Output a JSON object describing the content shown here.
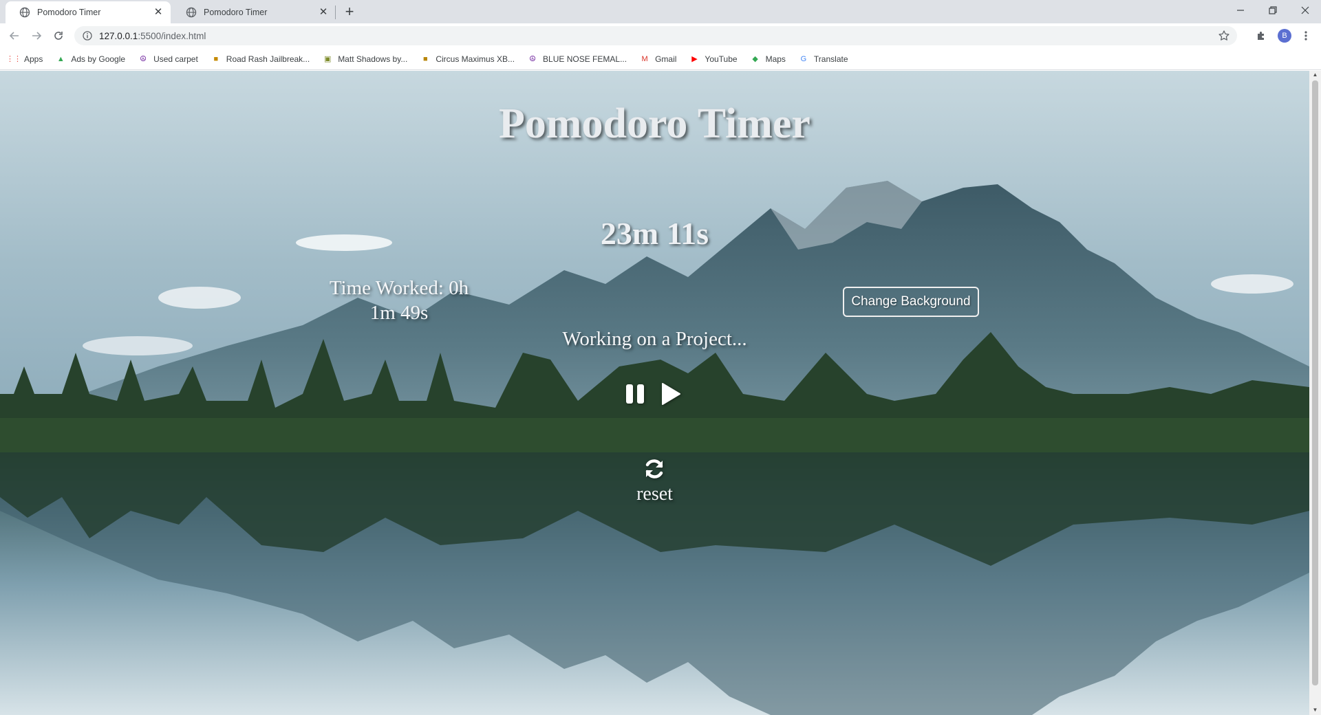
{
  "browser": {
    "tabs": [
      {
        "title": "Pomodoro Timer",
        "active": true
      },
      {
        "title": "Pomodoro Timer",
        "active": false
      }
    ],
    "url": {
      "host": "127.0.0.1",
      "rest": ":5500/index.html"
    },
    "profile_initial": "B",
    "bookmarks": [
      {
        "label": "Apps",
        "icon": "apps-grid-icon",
        "color": "#e8453c"
      },
      {
        "label": "Ads by Google",
        "icon": "google-ads-icon",
        "color": "#34a853"
      },
      {
        "label": "Used carpet",
        "icon": "peace-sign-icon",
        "color": "#6a1b9a"
      },
      {
        "label": "Road Rash Jailbreak...",
        "icon": "game-box-icon",
        "color": "#c58a00"
      },
      {
        "label": "Matt Shadows by...",
        "icon": "album-icon",
        "color": "#7d8b2a"
      },
      {
        "label": "Circus Maximus XB...",
        "icon": "game-box-icon",
        "color": "#b8860b"
      },
      {
        "label": "BLUE NOSE FEMAL...",
        "icon": "peace-sign-icon",
        "color": "#6a1b9a"
      },
      {
        "label": "Gmail",
        "icon": "gmail-icon",
        "color": "#d93025"
      },
      {
        "label": "YouTube",
        "icon": "youtube-icon",
        "color": "#ff0000"
      },
      {
        "label": "Maps",
        "icon": "maps-icon",
        "color": "#34a853"
      },
      {
        "label": "Translate",
        "icon": "translate-icon",
        "color": "#4285f4"
      }
    ]
  },
  "app": {
    "title": "Pomodoro Timer",
    "countdown": "23m 11s",
    "worked_line1": "Time Worked: 0h",
    "worked_line2": "1m 49s",
    "change_background_label": "Change Background",
    "status": "Working on a Project...",
    "reset_label": "reset"
  }
}
